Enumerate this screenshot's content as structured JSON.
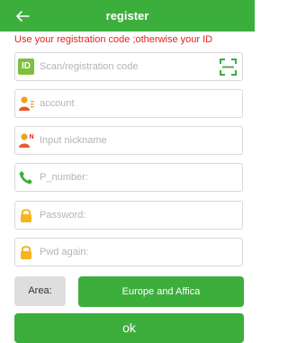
{
  "header": {
    "title": "register",
    "back_icon": "arrow-left-icon",
    "background_color": "#3cae3c"
  },
  "hint": "Use your registration code ;otherwise your ID",
  "fields": {
    "registration_code": {
      "placeholder": "Scan/registration code",
      "icon": "ID"
    },
    "account": {
      "placeholder": "account"
    },
    "nickname": {
      "placeholder": "Input nickname",
      "icon_badge": "N"
    },
    "phone": {
      "placeholder": "P_number:"
    },
    "password": {
      "placeholder": "Password:"
    },
    "password_again": {
      "placeholder": "Pwd again:"
    }
  },
  "area": {
    "label": "Area:",
    "selected": "Europe and Affica"
  },
  "submit_label": "ok",
  "colors": {
    "accent": "#3cae3c",
    "hint": "#e0231f",
    "user_icon": "#f0a020",
    "lock_icon": "#f5b51f",
    "phone_icon": "#3cae3c"
  }
}
